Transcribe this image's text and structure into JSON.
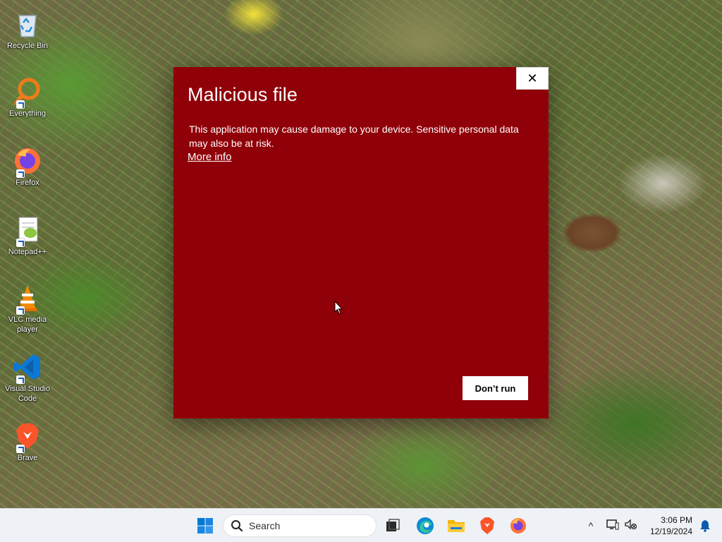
{
  "desktop": {
    "icons": [
      {
        "label": "Recycle Bin",
        "icon": "recycle-bin-icon"
      },
      {
        "label": "Everything",
        "icon": "everything-search-icon"
      },
      {
        "label": "Firefox",
        "icon": "firefox-icon"
      },
      {
        "label": "Notepad++",
        "icon": "notepad-plus-plus-icon"
      },
      {
        "label": "VLC media player",
        "icon": "vlc-icon"
      },
      {
        "label": "Visual Studio Code",
        "icon": "vscode-icon"
      },
      {
        "label": "Brave",
        "icon": "brave-icon"
      }
    ]
  },
  "dialog": {
    "title": "Malicious file",
    "message": "This application may cause damage to your device. Sensitive personal data may also be at risk.",
    "more_info": "More info",
    "primary_button": "Don’t run",
    "close_glyph": "✕",
    "background_color": "#900008"
  },
  "taskbar": {
    "search_placeholder": "Search",
    "pinned": [
      "start-icon",
      "search-icon",
      "task-view-icon",
      "edge-icon",
      "file-explorer-icon",
      "brave-icon",
      "firefox-icon"
    ],
    "tray": {
      "chevron": "^",
      "time": "3:06 PM",
      "date": "12/19/2024"
    }
  }
}
